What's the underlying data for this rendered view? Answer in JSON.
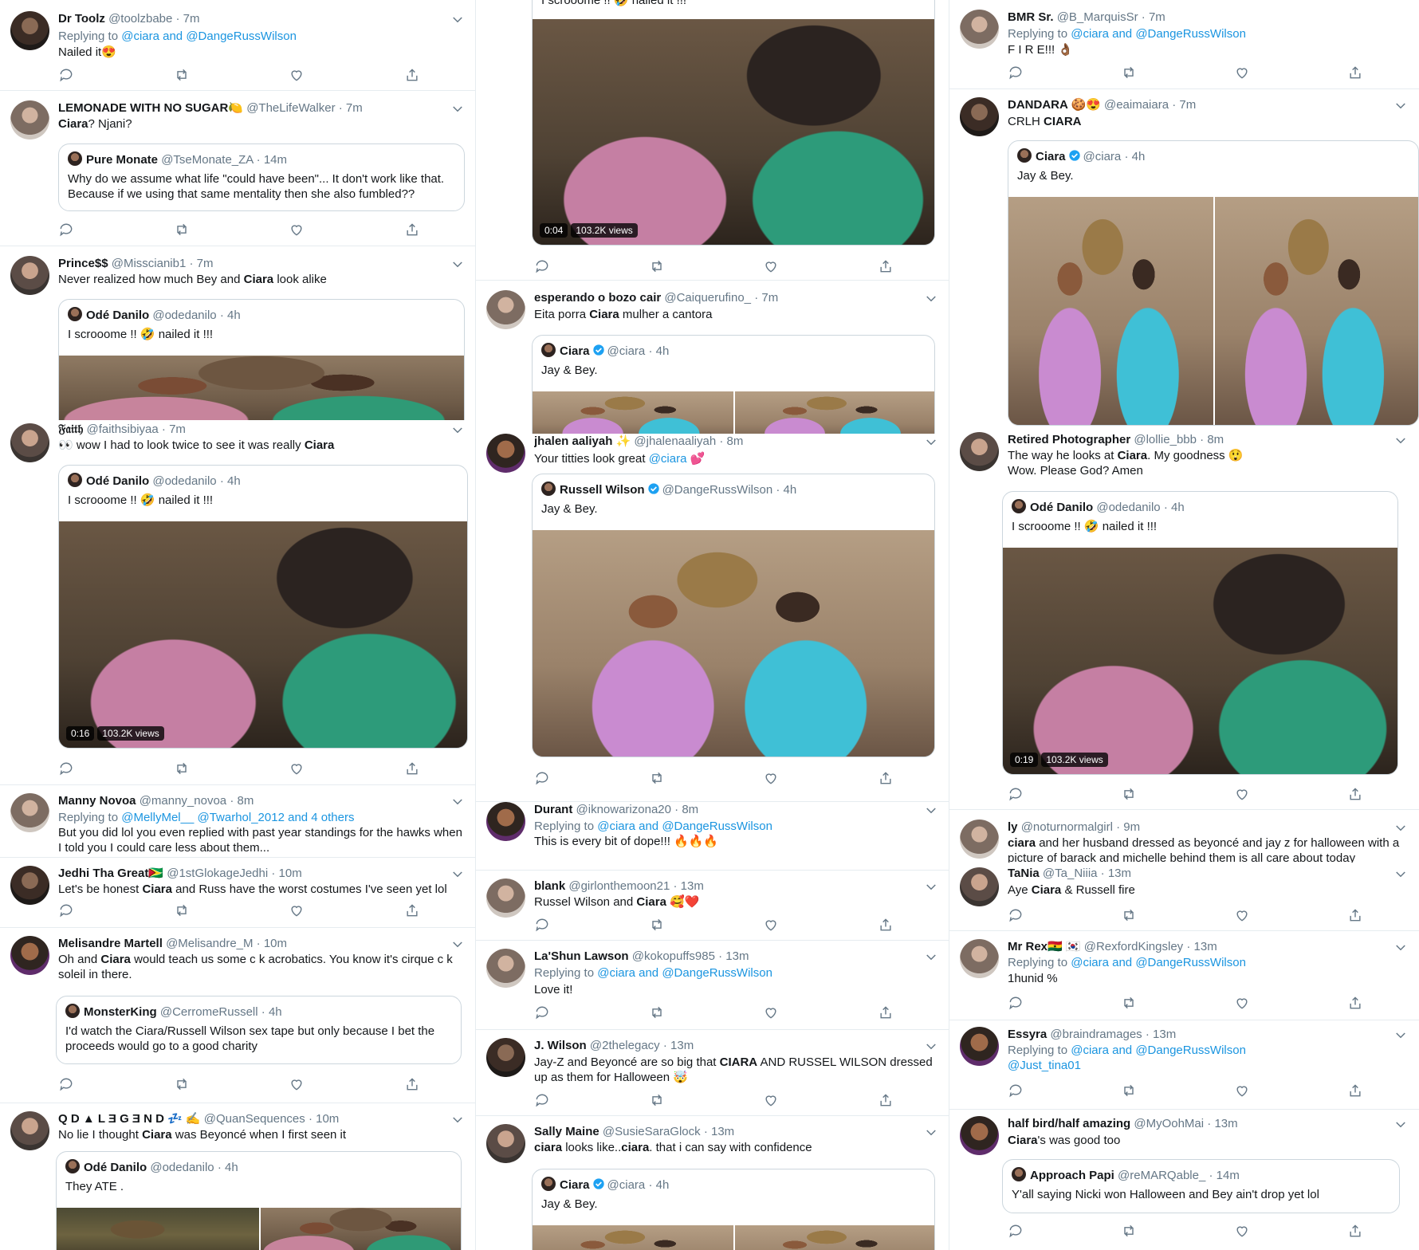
{
  "columns": [
    {
      "tweets": [
        {
          "name": "Dr Toolz",
          "handle": "@toolzbabe",
          "time": "· 7m",
          "replying_prefix": "Replying to",
          "replying_to": "@ciara and @DangeRussWilson",
          "text": "Nailed it😍"
        },
        {
          "name": "LEMONADE WITH NO SUGAR🍋",
          "handle": "@TheLifeWalker",
          "time": "· 7m",
          "text_bold": "Ciara",
          "text_rest": "? Njani?",
          "quote": {
            "name": "Pure Monate",
            "handle": "@TseMonate_ZA",
            "time": "· 14m",
            "text": "Why do we assume what life \"could have been\"... It don't work like that. Because if we using that same mentality then she also fumbled??"
          }
        },
        {
          "name": "Prince$$",
          "handle": "@Misscianib1",
          "time": "· 7m",
          "text_pre": "Never realized how much Bey and ",
          "text_bold": "Ciara",
          "text_rest": " look alike",
          "quote": {
            "name": "Odé Danilo",
            "handle": "@odedanilo",
            "time": "· 4h",
            "text": "I scrooome !! 🤣 nailed it !!!"
          }
        },
        {
          "name": "𝔉𝔞𝔦𝔱𝔥",
          "handle": "@faithsibiyaa",
          "time": "· 7m",
          "text_pre": "👀 wow I had to look twice to see it was really ",
          "text_bold": "Ciara",
          "quote": {
            "name": "Odé Danilo",
            "handle": "@odedanilo",
            "time": "· 4h",
            "text": "I scrooome !! 🤣 nailed it !!!",
            "video_time": "0:16",
            "views": "103.2K views"
          }
        },
        {
          "name": "Manny Novoa",
          "handle": "@manny_novoa",
          "time": "· 8m",
          "replying_prefix": "Replying to",
          "replying_to": "@MellyMel__ @Twarhol_2012 and 4 others",
          "text": "But you did lol you even replied with past year standings for the hawks when I told you I could care less about them..."
        },
        {
          "name": "Jedhi Tha Great🇬🇾",
          "handle": "@1stGlokageJedhi",
          "time": "· 10m",
          "text_pre": "Let's be honest ",
          "text_bold": "Ciara",
          "text_rest": " and Russ have the worst costumes I've seen yet lol"
        },
        {
          "name": "Melisandre Martell",
          "handle": "@Melisandre_M",
          "time": "· 10m",
          "text_pre": "Oh and ",
          "text_bold": "Ciara",
          "text_rest": " would teach us some c‌ k acrobatics. You know it's cirque c‌ k soleil in there.",
          "quote": {
            "name": "MonsterKing",
            "handle": "@CerromeRussell",
            "time": "· 4h",
            "text": "I'd watch the Ciara/Russell Wilson sex tape but only because I bet the proceeds would go to a good charity"
          }
        },
        {
          "name": "Q D ▲ L Ǝ G Ǝ N D 💤 ✍️",
          "handle": "@QuanSequences",
          "time": "· 10m",
          "text_pre": "No lie I thought ",
          "text_bold": "Ciara",
          "text_rest": " was Beyoncé when I first seen it",
          "quote": {
            "name": "Odé Danilo",
            "handle": "@odedanilo",
            "time": "· 4h",
            "text": "They ATE ."
          }
        }
      ]
    },
    {
      "tweets": [
        {
          "quote_text": "I scrooome !! 🤣 nailed it !!!",
          "video_time": "0:04",
          "views": "103.2K views"
        },
        {
          "name": "esperando o bozo cair",
          "handle": "@Caiquerufino_",
          "time": "· 7m",
          "text_pre": "Eita porra ",
          "text_bold": "Ciara",
          "text_rest": " mulher a cantora",
          "quote": {
            "name": "Ciara",
            "handle": "@ciara",
            "time": "· 4h",
            "text": "Jay & Bey."
          }
        },
        {
          "name": "jhalen aaliyah ✨",
          "handle": "@jhalenaaliyah",
          "time": "· 8m",
          "text_pre": "Your titties look great ",
          "text_link": "@ciara",
          "text_rest": " 💕",
          "quote": {
            "name": "Russell Wilson",
            "handle": "@DangeRussWilson",
            "time": "· 4h",
            "text": "Jay & Bey."
          }
        },
        {
          "name": "Durant",
          "handle": "@iknowarizona20",
          "time": "· 8m",
          "replying_prefix": "Replying to",
          "replying_to": "@ciara and @DangeRussWilson",
          "text": "This is every bit of dope!!! 🔥🔥🔥"
        },
        {
          "name": "blank",
          "handle": "@girlonthemoon21",
          "time": "· 13m",
          "text_pre": "Russel Wilson and ",
          "text_bold": "Ciara",
          "text_rest": " 🥰❤️"
        },
        {
          "name": "La'Shun Lawson",
          "handle": "@kokopuffs985",
          "time": "· 13m",
          "replying_prefix": "Replying to",
          "replying_to": "@ciara and @DangeRussWilson",
          "text": "Love it!"
        },
        {
          "name": "J. Wilson",
          "handle": "@2thelegacy",
          "time": "· 13m",
          "text_pre": "Jay-Z and Beyoncé are so big that ",
          "text_bold": "CIARA",
          "text_rest": " AND RUSSEL WILSON dressed up as them for Halloween 🤯"
        },
        {
          "name": "Sally Maine",
          "handle": "@SusieSaraGlock",
          "time": "· 13m",
          "text_bold": "ciara",
          "text_rest": " looks like..",
          "text_bold2": "ciara",
          "text_rest2": ". that i can say with confidence",
          "quote": {
            "name": "Ciara",
            "handle": "@ciara",
            "time": "· 4h",
            "text": "Jay & Bey."
          }
        }
      ]
    },
    {
      "tweets": [
        {
          "name": "BMR Sr.",
          "handle": "@B_MarquisSr",
          "time": "· 7m",
          "replying_prefix": "Replying to",
          "replying_to": "@ciara and @DangeRussWilson",
          "text": "F I R E!!! 👌🏾"
        },
        {
          "name": "DANDARA 🍪😍",
          "handle": "@eaimaiara",
          "time": "· 7m",
          "text_pre": "CRLH ",
          "text_bold": "CIARA",
          "quote": {
            "name": "Ciara",
            "handle": "@ciara",
            "time": "· 4h",
            "text": "Jay & Bey."
          }
        },
        {
          "name": "Retired Photographer",
          "handle": "@lollie_bbb",
          "time": "· 8m",
          "text_pre": "The way he looks at ",
          "text_bold": "Ciara",
          "text_rest": ". My goodness 😲 Wow. Please God? Amen",
          "quote": {
            "name": "Odé Danilo",
            "handle": "@odedanilo",
            "time": "· 4h",
            "text": "I scrooome !! 🤣 nailed it !!!",
            "video_time": "0:19",
            "views": "103.2K views"
          }
        },
        {
          "name": "ly",
          "handle": "@noturnormalgirl",
          "time": "· 9m",
          "text_bold": "ciara",
          "text_rest": " and her husband dressed as beyoncé and jay z for halloween with a picture of barack and michelle behind them is all care about today"
        },
        {
          "name": "TaNia",
          "handle": "@Ta_Niiia",
          "time": "· 13m",
          "text_pre": "Aye ",
          "text_bold": "Ciara",
          "text_rest": " & Russell fire"
        },
        {
          "name": "Mr Rex🇬🇭 🇰🇷",
          "handle": "@RexfordKingsley",
          "time": "· 13m",
          "replying_prefix": "Replying to",
          "replying_to": "@ciara and @DangeRussWilson",
          "text": "1hunid %"
        },
        {
          "name": "Essyra",
          "handle": "@braindramages",
          "time": "· 13m",
          "replying_prefix": "Replying to",
          "replying_to": "@ciara and @DangeRussWilson",
          "replying_to2": "@Just_tina01"
        },
        {
          "name": "half bird/half amazing",
          "handle": "@MyOohMai",
          "time": "· 13m",
          "text_bold": "Ciara",
          "text_rest": "'s was good too",
          "quote": {
            "name": "Approach Papi",
            "handle": "@reMARQable_",
            "time": "· 14m",
            "text": "Y'all saying Nicki won Halloween and Bey ain't drop yet lol"
          }
        }
      ]
    }
  ],
  "colors": {
    "link": "#1b95e0",
    "muted": "#657786",
    "text": "#14171a",
    "border": "#e6ecf0"
  }
}
